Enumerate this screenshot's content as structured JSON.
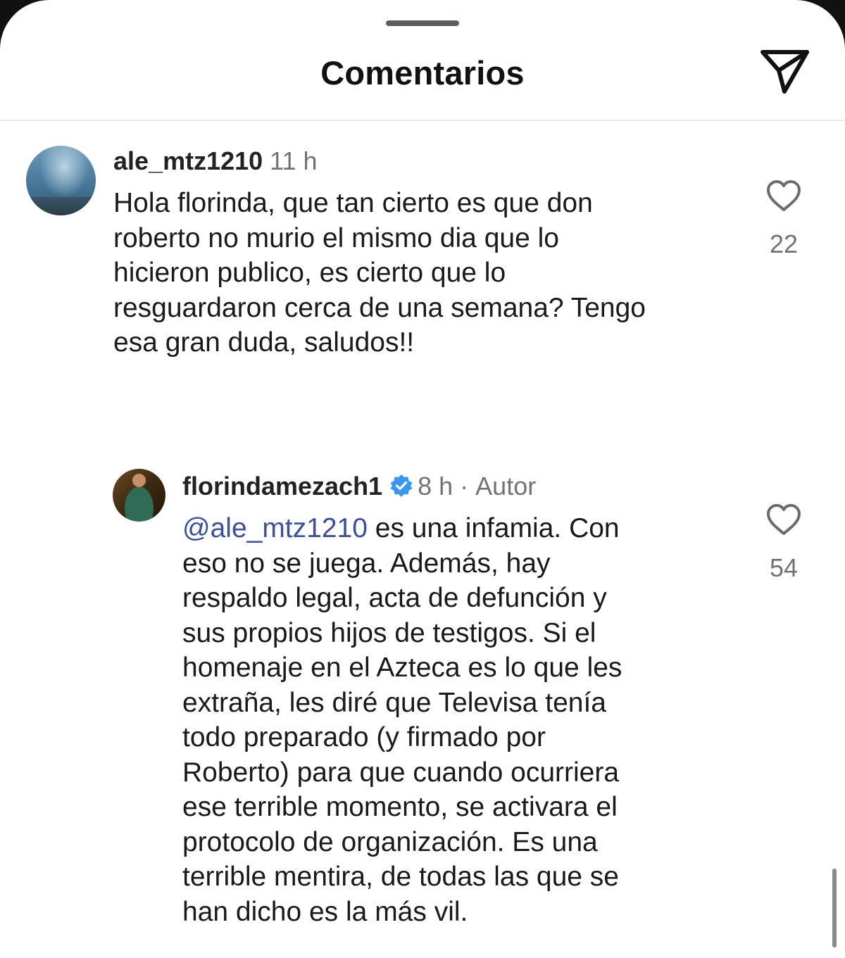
{
  "header": {
    "title": "Comentarios",
    "share_icon": "send-paper-plane-icon"
  },
  "comments": [
    {
      "username": "ale_mtz1210",
      "time": "11 h",
      "text": "Hola florinda, que tan cierto es que don\nroberto no murio el mismo dia que lo\nhicieron publico, es cierto que lo\nresguardaron cerca de una semana? Tengo\nesa gran duda, saludos!!",
      "likes": "22"
    },
    {
      "username": "florindamezach1",
      "verified": true,
      "time": "8 h",
      "separator": "·",
      "author_label": "Autor",
      "mention": "@ale_mtz1210",
      "text": " es una infamia. Con\neso no se juega. Además, hay\nrespaldo legal, acta de defunción y\nsus propios hijos de testigos. Si el\nhomenaje en el Azteca es lo que les\nextraña, les diré que Televisa tenía\ntodo preparado (y firmado por\nRoberto) para que cuando ocurriera\nese terrible momento, se activara el\nprotocolo de organización. Es una\nterrible mentira, de todas las que se\nhan dicho es la más vil.",
      "likes": "54"
    }
  ],
  "colors": {
    "mention": "#3a4fa0",
    "verified": "#3897f0",
    "meta": "#737373"
  }
}
